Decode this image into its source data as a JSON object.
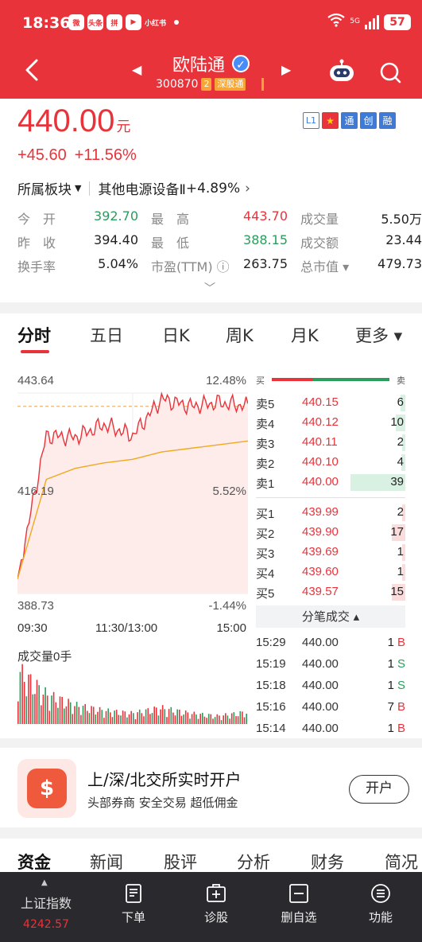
{
  "status": {
    "time": "18:36",
    "apps": [
      "微",
      "头条",
      "拼",
      "▶"
    ],
    "small_text": "小红书",
    "net": "5G",
    "battery": "57"
  },
  "header": {
    "stock_name": "欧陆通",
    "code": "300870",
    "tag_num": "2",
    "exchange_tag": "深股通"
  },
  "quote": {
    "price": "440.00",
    "unit": "元",
    "change_abs": "+45.60",
    "change_pct": "+11.56%",
    "badges": [
      "L1",
      "★",
      "通",
      "创",
      "融"
    ]
  },
  "sector": {
    "label": "所属板块",
    "name": "其他电源设备Ⅱ",
    "pct": "+4.89%"
  },
  "stats": {
    "rows": [
      [
        {
          "label": "今　开",
          "value": "392.70",
          "color": "green"
        },
        {
          "label": "最　高",
          "value": "443.70",
          "color": "red"
        },
        {
          "label": "成交量",
          "value": "5.50万",
          "color": ""
        }
      ],
      [
        {
          "label": "昨　收",
          "value": "394.40",
          "color": ""
        },
        {
          "label": "最　低",
          "value": "388.15",
          "color": "green"
        },
        {
          "label": "成交额",
          "value": "23.44",
          "color": ""
        }
      ],
      [
        {
          "label": "换手率",
          "value": "5.04%",
          "color": ""
        },
        {
          "label": "市盈(TTM) ⓘ",
          "value": "263.75",
          "color": ""
        },
        {
          "label": "总市值 ▾",
          "value": "479.73",
          "color": ""
        }
      ]
    ]
  },
  "tabs": [
    "分时",
    "五日",
    "日K",
    "周K",
    "月K",
    "更多 ▾"
  ],
  "chart": {
    "price_high": "443.64",
    "price_mid": "416.19",
    "price_low": "388.73",
    "pct_high": "12.48%",
    "pct_mid": "5.52%",
    "pct_low": "-1.44%",
    "time_start": "09:30",
    "time_mid": "11:30/13:00",
    "time_end": "15:00",
    "volume_label": "成交量0手"
  },
  "chart_data": {
    "type": "line",
    "title": "",
    "xlabel": "",
    "ylabel": "",
    "ylim": [
      388.73,
      443.64
    ],
    "x": [
      "09:30",
      "10:00",
      "10:30",
      "11:00",
      "11:30/13:00",
      "13:30",
      "14:00",
      "14:30",
      "15:00"
    ],
    "series": [
      {
        "values": [
          392.7,
          432.0,
          431.5,
          435.0,
          432.0,
          442.0,
          440.0,
          441.0,
          440.0
        ]
      },
      {
        "values": [
          392.7,
          420.0,
          423.0,
          424.5,
          425.5,
          427.5,
          428.5,
          429.5,
          430.5
        ]
      }
    ],
    "volume_relative": [
      1.0,
      0.55,
      0.35,
      0.25,
      0.2,
      0.3,
      0.2,
      0.15,
      0.22
    ]
  },
  "book": {
    "buy_label": "买",
    "sell_label": "卖",
    "asks": [
      {
        "label": "卖5",
        "price": "440.15",
        "vol": "6",
        "w": 0.05
      },
      {
        "label": "卖4",
        "price": "440.12",
        "vol": "10",
        "w": 0.1
      },
      {
        "label": "卖3",
        "price": "440.11",
        "vol": "2",
        "w": 0.03
      },
      {
        "label": "卖2",
        "price": "440.10",
        "vol": "4",
        "w": 0.04
      },
      {
        "label": "卖1",
        "price": "440.00",
        "vol": "39",
        "w": 0.6
      }
    ],
    "bids": [
      {
        "label": "买1",
        "price": "439.99",
        "vol": "2",
        "w": 0.03
      },
      {
        "label": "买2",
        "price": "439.90",
        "vol": "17",
        "w": 0.15
      },
      {
        "label": "买3",
        "price": "439.69",
        "vol": "1",
        "w": 0.02
      },
      {
        "label": "买4",
        "price": "439.60",
        "vol": "1",
        "w": 0.02
      },
      {
        "label": "买5",
        "price": "439.57",
        "vol": "15",
        "w": 0.15
      }
    ],
    "ticks_title": "分笔成交 ▴",
    "ticks": [
      {
        "time": "15:29",
        "price": "440.00",
        "vol": "1",
        "dir": "B"
      },
      {
        "time": "15:19",
        "price": "440.00",
        "vol": "1",
        "dir": "S"
      },
      {
        "time": "15:18",
        "price": "440.00",
        "vol": "1",
        "dir": "S"
      },
      {
        "time": "15:16",
        "price": "440.00",
        "vol": "7",
        "dir": "B"
      },
      {
        "time": "15:14",
        "price": "440.00",
        "vol": "1",
        "dir": "B"
      }
    ]
  },
  "banner": {
    "icon": "$",
    "title": "上/深/北交所实时开户",
    "desc": "头部券商  安全交易  超低佣金",
    "button": "开户"
  },
  "bottom_tabs": [
    "资金",
    "新闻",
    "股评",
    "分析",
    "财务",
    "简况"
  ],
  "toolbar": {
    "index_name": "上证指数",
    "index_value": "4242.57",
    "items": [
      {
        "label": "下单",
        "icon": "order-icon"
      },
      {
        "label": "诊股",
        "icon": "diagnose-icon"
      },
      {
        "label": "删自选",
        "icon": "remove-watchlist-icon"
      },
      {
        "label": "功能",
        "icon": "menu-icon"
      }
    ]
  },
  "colors": {
    "brand_red": "#e8333b",
    "green": "#2a9d5c",
    "avg_line": "#f0a81e",
    "toolbar_bg": "#2a2a2e"
  }
}
